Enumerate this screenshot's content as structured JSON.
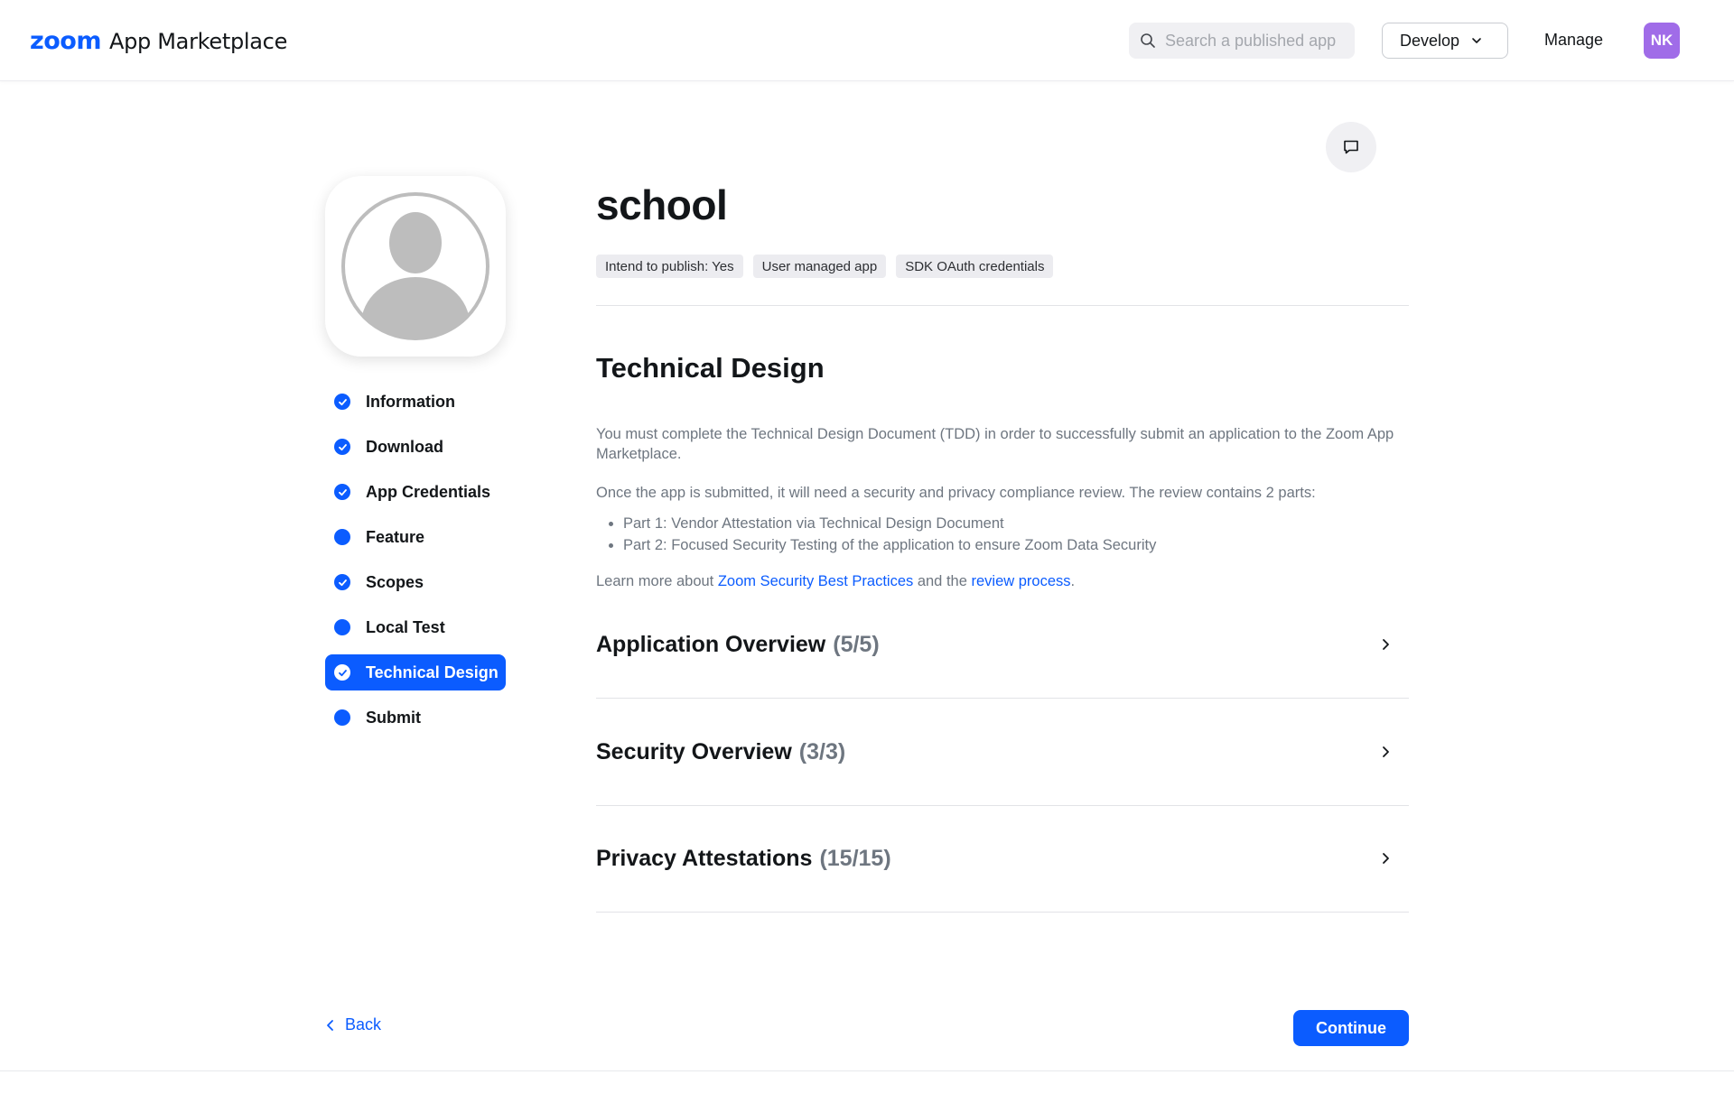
{
  "header": {
    "logo_zoom": "zoom",
    "logo_text": "App Marketplace",
    "search_placeholder": "Search a published app",
    "develop_label": "Develop",
    "manage_label": "Manage",
    "user_initials": "NK",
    "user_avatar_color": "#a06ce8"
  },
  "sidebar": {
    "steps": [
      {
        "label": "Information",
        "status": "complete"
      },
      {
        "label": "Download",
        "status": "complete"
      },
      {
        "label": "App Credentials",
        "status": "complete"
      },
      {
        "label": "Feature",
        "status": "incomplete"
      },
      {
        "label": "Scopes",
        "status": "complete"
      },
      {
        "label": "Local Test",
        "status": "incomplete"
      },
      {
        "label": "Technical Design",
        "status": "complete",
        "active": true
      },
      {
        "label": "Submit",
        "status": "incomplete"
      }
    ]
  },
  "app": {
    "name": "school",
    "tags": [
      "Intend to publish: Yes",
      "User managed app",
      "SDK OAuth credentials"
    ]
  },
  "section": {
    "title": "Technical Design",
    "paragraph1": "You must complete the Technical Design Document (TDD) in order to successfully submit an application to the Zoom App Marketplace.",
    "paragraph2": "Once the app is submitted, it will need a security and privacy compliance review. The review contains 2 parts:",
    "bullets": [
      "Part 1: Vendor Attestation via Technical Design Document",
      "Part 2: Focused Security Testing of the application to ensure Zoom Data Security"
    ],
    "learn_prefix": "Learn more about ",
    "learn_link1": "Zoom Security Best Practices",
    "learn_middle": " and the ",
    "learn_link2": "review process",
    "learn_suffix": "."
  },
  "accordions": [
    {
      "title": "Application Overview",
      "count": "(5/5)"
    },
    {
      "title": "Security Overview",
      "count": "(3/3)"
    },
    {
      "title": "Privacy Attestations",
      "count": "(15/15)"
    }
  ],
  "footer": {
    "back_label": "Back",
    "continue_label": "Continue"
  },
  "colors": {
    "accent": "#0b5cff"
  }
}
